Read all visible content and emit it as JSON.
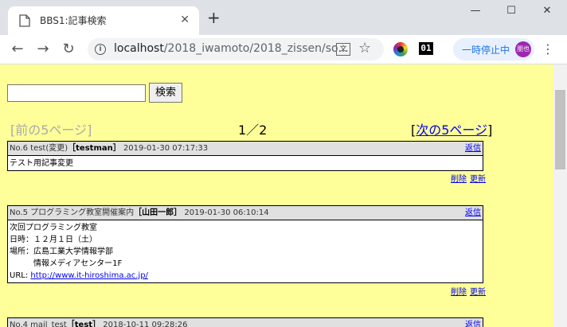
{
  "browser": {
    "tab_title": "BBS1:記事検索",
    "url_host": "localhost",
    "url_path": "/2018_iwamoto/2018_zissen/so...",
    "ext_badge": "01",
    "pause_label": "一時停止中",
    "avatar_text": "朋也"
  },
  "search": {
    "value": "",
    "button_label": "検索"
  },
  "pagination": {
    "prev_label": "[前の5ページ]",
    "current": "1／2",
    "next_open": "[",
    "next_label": "次の5ページ",
    "next_close": "]"
  },
  "posts": [
    {
      "header": "No.6 test(変更)",
      "author": "［testman］",
      "datetime": "2019-01-30 07:17:33",
      "body": "テスト用記事変更",
      "link": "",
      "reply": "返信",
      "delete": "削除",
      "update": "更新"
    },
    {
      "header": "No.5 プログラミング教室開催案内",
      "author": "［山田一郎］",
      "datetime": "2019-01-30 06:10:14",
      "body": "次回プログラミング教室\n日時：１２月１日（土）\n場所：広島工業大学情報学部\n　　　情報メディアセンター1F",
      "url_label": "URL: ",
      "link": "http://www.it-hiroshima.ac.jp/",
      "reply": "返信",
      "delete": "削除",
      "update": "更新"
    },
    {
      "header": "No.4 mail_test",
      "author": "［test］",
      "datetime": "2018-10-11 09:28:26",
      "reply": "返信"
    }
  ]
}
